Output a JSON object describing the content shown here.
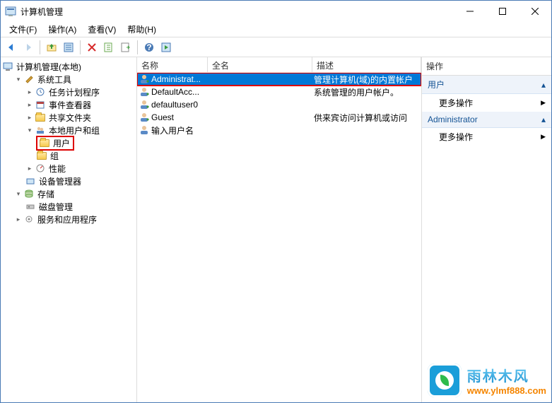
{
  "window": {
    "title": "计算机管理"
  },
  "menu": {
    "file": "文件(F)",
    "action": "操作(A)",
    "view": "查看(V)",
    "help": "帮助(H)"
  },
  "tree": {
    "root": "计算机管理(本地)",
    "system_tools": "系统工具",
    "task_scheduler": "任务计划程序",
    "event_viewer": "事件查看器",
    "shared_folders": "共享文件夹",
    "local_users": "本地用户和组",
    "users": "用户",
    "groups": "组",
    "performance": "性能",
    "device_manager": "设备管理器",
    "storage": "存储",
    "disk_management": "磁盘管理",
    "services_apps": "服务和应用程序"
  },
  "list": {
    "col_name": "名称",
    "col_fullname": "全名",
    "col_desc": "描述",
    "rows": [
      {
        "name": "Administrat...",
        "fullname": "",
        "desc": "管理计算机(域)的内置帐户"
      },
      {
        "name": "DefaultAcc...",
        "fullname": "",
        "desc": "系统管理的用户帐户。"
      },
      {
        "name": "defaultuser0",
        "fullname": "",
        "desc": ""
      },
      {
        "name": "Guest",
        "fullname": "",
        "desc": "供来宾访问计算机或访问"
      },
      {
        "name": "输入用户名",
        "fullname": "",
        "desc": ""
      }
    ]
  },
  "actions": {
    "title": "操作",
    "section1": "用户",
    "more1": "更多操作",
    "section2": "Administrator",
    "more2": "更多操作"
  },
  "watermark": {
    "brand_cn": "雨林木风",
    "url": "www.ylmf888.com"
  },
  "icons": {
    "app": "mmc-icon",
    "back": "back-arrow-icon",
    "forward": "forward-arrow-icon",
    "up": "up-folder-icon",
    "properties": "properties-icon",
    "delete": "delete-icon",
    "refresh": "refresh-icon",
    "export": "export-icon",
    "help": "help-icon",
    "run": "run-icon"
  }
}
